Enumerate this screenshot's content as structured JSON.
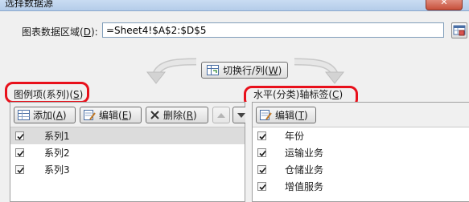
{
  "dialog": {
    "title": "选择数据源",
    "close_glyph": "✕"
  },
  "range": {
    "label_prefix": "图表数据区域(",
    "label_accel": "D",
    "label_suffix": "):",
    "value": "=Sheet4!$A$2:$D$5"
  },
  "switch": {
    "label_prefix": "切换行/列(",
    "label_accel": "W",
    "label_suffix": ")"
  },
  "series_panel": {
    "title_prefix": "图例项(系列)(",
    "title_accel": "S",
    "title_suffix": ")",
    "add": {
      "prefix": "添加(",
      "accel": "A",
      "suffix": ")"
    },
    "edit": {
      "prefix": "编辑(",
      "accel": "E",
      "suffix": ")"
    },
    "remove": {
      "prefix": "删除(",
      "accel": "R",
      "suffix": ")"
    },
    "items": [
      {
        "label": "系列1",
        "checked": true,
        "selected": true
      },
      {
        "label": "系列2",
        "checked": true,
        "selected": false
      },
      {
        "label": "系列3",
        "checked": true,
        "selected": false
      }
    ]
  },
  "category_panel": {
    "title_prefix": "水平(分类)轴标签(",
    "title_accel": "C",
    "title_suffix": ")",
    "edit": {
      "prefix": "编辑(",
      "accel": "T",
      "suffix": ")"
    },
    "items": [
      {
        "label": "年份",
        "checked": true
      },
      {
        "label": "运输业务",
        "checked": true
      },
      {
        "label": "仓储业务",
        "checked": true
      },
      {
        "label": "增值服务",
        "checked": true
      }
    ]
  },
  "colors": {
    "highlight": "#e8101b",
    "check": "#1a1a1a"
  }
}
